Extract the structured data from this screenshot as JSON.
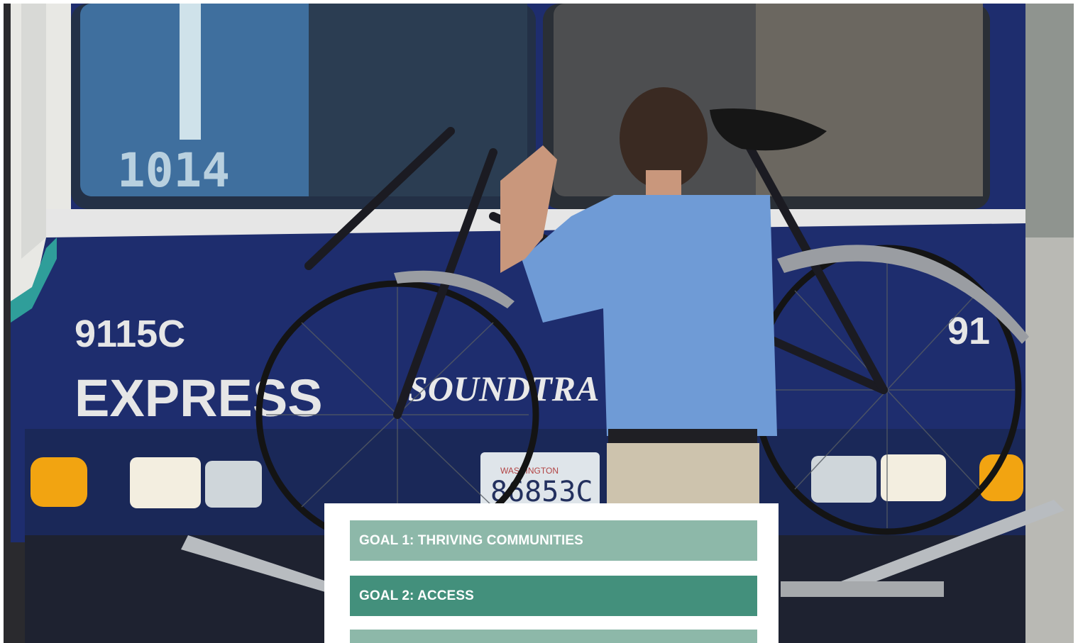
{
  "colors": {
    "goal_1": "#8db8a9",
    "goal_2": "#43907c",
    "goal_3": "#8db8a9",
    "bus_body": "#1e2d6e",
    "shirt": "#6f9bd6"
  },
  "photo": {
    "subject": "man loading bicycle onto bus bike rack",
    "bus_number": "9115C",
    "route_sign": "EXPRESS",
    "fleet_number": "1014",
    "brand": "SOUNDTRA",
    "right_number": "91",
    "plate": "86853C",
    "plate_state": "WASHINGTON"
  },
  "goals": [
    {
      "label": "GOAL 1: THRIVING COMMUNITIES"
    },
    {
      "label": "GOAL 2: ACCESS"
    },
    {
      "label": ""
    }
  ]
}
